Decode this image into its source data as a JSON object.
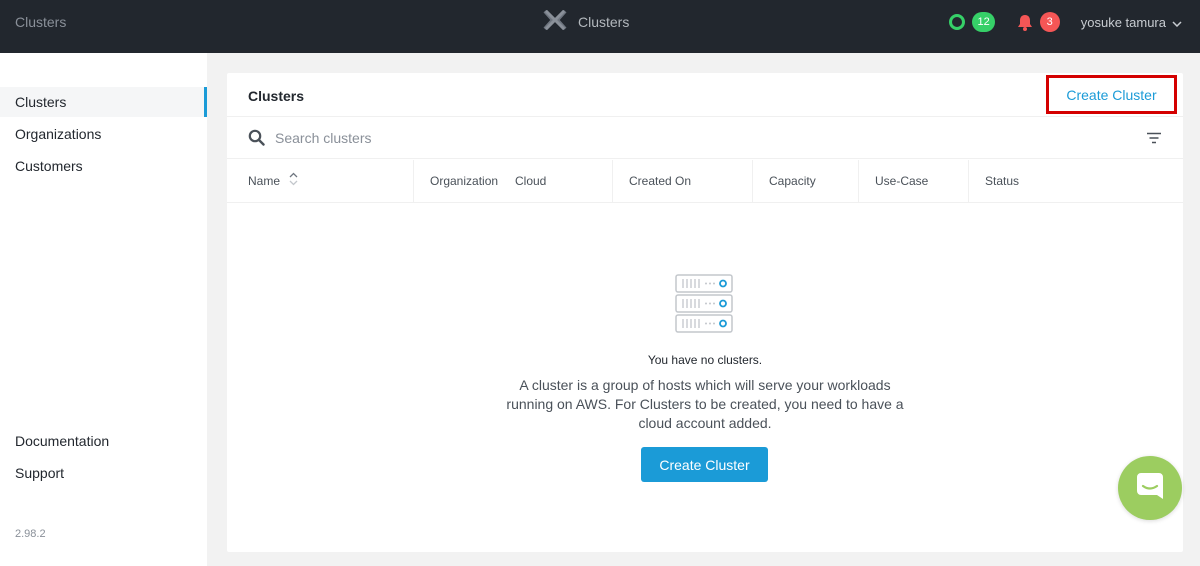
{
  "topbar": {
    "section_label": "Clusters",
    "app_title": "Clusters",
    "green_badge": "12",
    "alert_badge": "3",
    "user_name": "yosuke tamura"
  },
  "sidebar": {
    "items": [
      {
        "label": "Clusters"
      },
      {
        "label": "Organizations"
      },
      {
        "label": "Customers"
      }
    ],
    "footer_items": [
      {
        "label": "Documentation"
      },
      {
        "label": "Support"
      }
    ],
    "version": "2.98.2"
  },
  "panel": {
    "title": "Clusters",
    "create_link_label": "Create Cluster",
    "search_placeholder": "Search clusters",
    "columns": [
      "Name",
      "Organization",
      "Cloud",
      "Created On",
      "Capacity",
      "Use-Case",
      "Status"
    ],
    "empty_title": "You have no clusters.",
    "empty_description": "A cluster is a group of hosts which will serve your workloads running on AWS. For Clusters to be created, you need to have a cloud account added.",
    "create_button_label": "Create Cluster"
  },
  "colors": {
    "accent": "#1b9bd7",
    "topbar": "#22272e",
    "badge_green": "#36d068",
    "badge_red": "#f55656",
    "chat": "#9ccd60"
  },
  "icons": [
    "logo-x-icon",
    "status-ring-icon",
    "bell-icon",
    "chevron-down-icon",
    "search-icon",
    "filter-icon",
    "sort-icon",
    "server-stack-icon",
    "chat-icon"
  ]
}
